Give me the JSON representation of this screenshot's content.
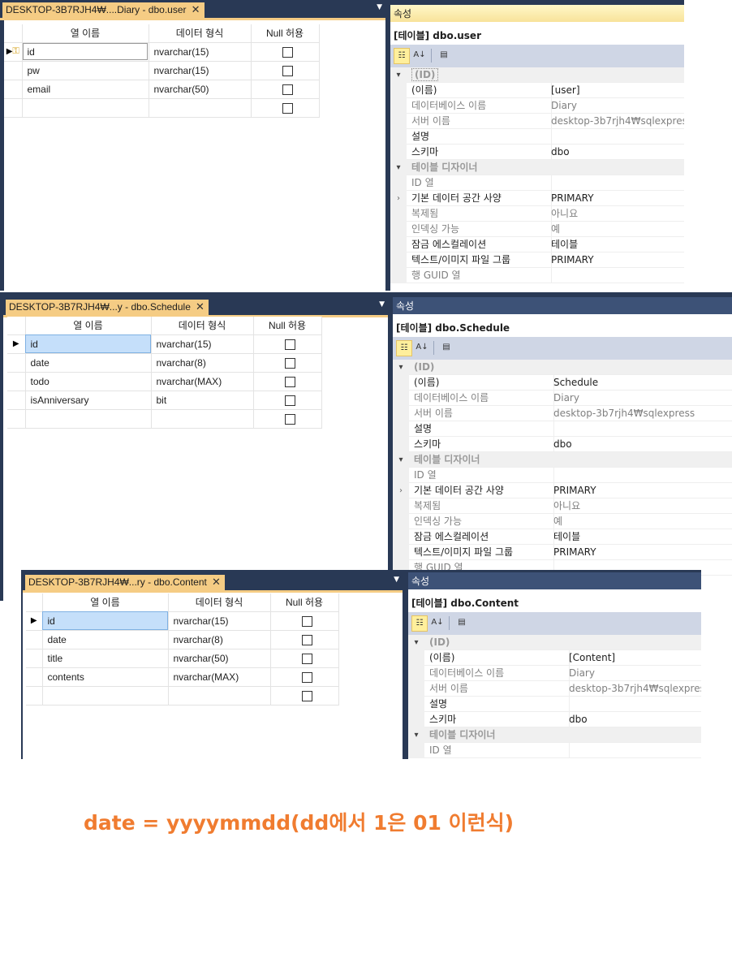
{
  "common": {
    "col_name_header": "열 이름",
    "type_header": "데이터 형식",
    "null_header": "Null 허용",
    "props_title": "속성",
    "cat_id": "(ID)",
    "cat_designer": "테이블 디자이너",
    "p_name": "(이름)",
    "p_db": "데이터베이스 이름",
    "p_server": "서버 이름",
    "p_desc": "설명",
    "p_schema": "스키마",
    "p_id_col": "ID 열",
    "p_dataspace": "기본 데이터 공간 사양",
    "p_replicated": "복제됨",
    "p_indexable": "인덱싱 가능",
    "p_lock": "잠금 에스컬레이션",
    "p_textimage": "텍스트/이미지 파일 그룹",
    "p_rowguid": "행 GUID 열",
    "v_db": "Diary",
    "v_server": "desktop-3b7rjh4₩sqlexpress",
    "v_schema": "dbo",
    "v_dataspace": "PRIMARY",
    "v_replicated": "아니요",
    "v_indexable": "예",
    "v_lock": "테이블",
    "v_textimage": "PRIMARY",
    "tb_categorized_icon": "categorized-icon",
    "tb_alpha_icon": "alphabetical-icon",
    "tb_pages_icon": "property-pages-icon"
  },
  "panel1": {
    "tab": "DESKTOP-3B7RJH4₩....Diary - dbo.user",
    "object": "[테이블] dbo.user",
    "name": "[user]",
    "rows": [
      {
        "name": "id",
        "type": "nvarchar(15)"
      },
      {
        "name": "pw",
        "type": "nvarchar(15)"
      },
      {
        "name": "email",
        "type": "nvarchar(50)"
      },
      {
        "name": "",
        "type": ""
      }
    ]
  },
  "panel2": {
    "tab": "DESKTOP-3B7RJH4₩...y - dbo.Schedule",
    "object": "[테이블] dbo.Schedule",
    "name": "Schedule",
    "rows": [
      {
        "name": "id",
        "type": "nvarchar(15)"
      },
      {
        "name": "date",
        "type": "nvarchar(8)"
      },
      {
        "name": "todo",
        "type": "nvarchar(MAX)"
      },
      {
        "name": "isAnniversary",
        "type": "bit"
      },
      {
        "name": "",
        "type": ""
      }
    ]
  },
  "panel3": {
    "tab": "DESKTOP-3B7RJH4₩...ry - dbo.Content",
    "object": "[테이블] dbo.Content",
    "name": "[Content]",
    "rows": [
      {
        "name": "id",
        "type": "nvarchar(15)"
      },
      {
        "name": "date",
        "type": "nvarchar(8)"
      },
      {
        "name": "title",
        "type": "nvarchar(50)"
      },
      {
        "name": "contents",
        "type": "nvarchar(MAX)"
      },
      {
        "name": "",
        "type": ""
      }
    ]
  },
  "note": "date = yyyymmdd(dd에서 1은  01 이런식)",
  "colors": {
    "vs_navy": "#293955",
    "tab_gold": "#f5cc84",
    "selected_cell": "#c5dffa",
    "note_orange": "#f07c30"
  }
}
